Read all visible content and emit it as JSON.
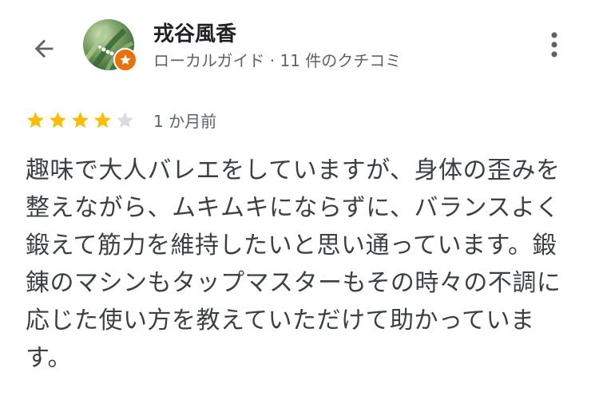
{
  "header": {
    "back_icon": "arrow-back-icon",
    "reviewer_name": "戎谷風香",
    "reviewer_meta": "ローカルガイド · 11 件のクチコミ",
    "badge_icon": "local-guide-star-icon",
    "more_icon": "more-vert-icon"
  },
  "review": {
    "rating": 4,
    "max_rating": 5,
    "time": "1 か月前",
    "text": "趣味で大人バレエをしていますが、身体の歪みを整えながら、ムキムキにならずに、バランスよく鍛えて筋力を維持したいと思い通っています。鍛錬のマシンもタップマスターもその時々の不調に応じた使い方を教えていただけて助かっています。"
  },
  "colors": {
    "star_filled": "#fbbc04",
    "star_empty": "#dadce0",
    "badge": "#e8710a",
    "text_primary": "#202124",
    "text_secondary": "#5f6368"
  }
}
